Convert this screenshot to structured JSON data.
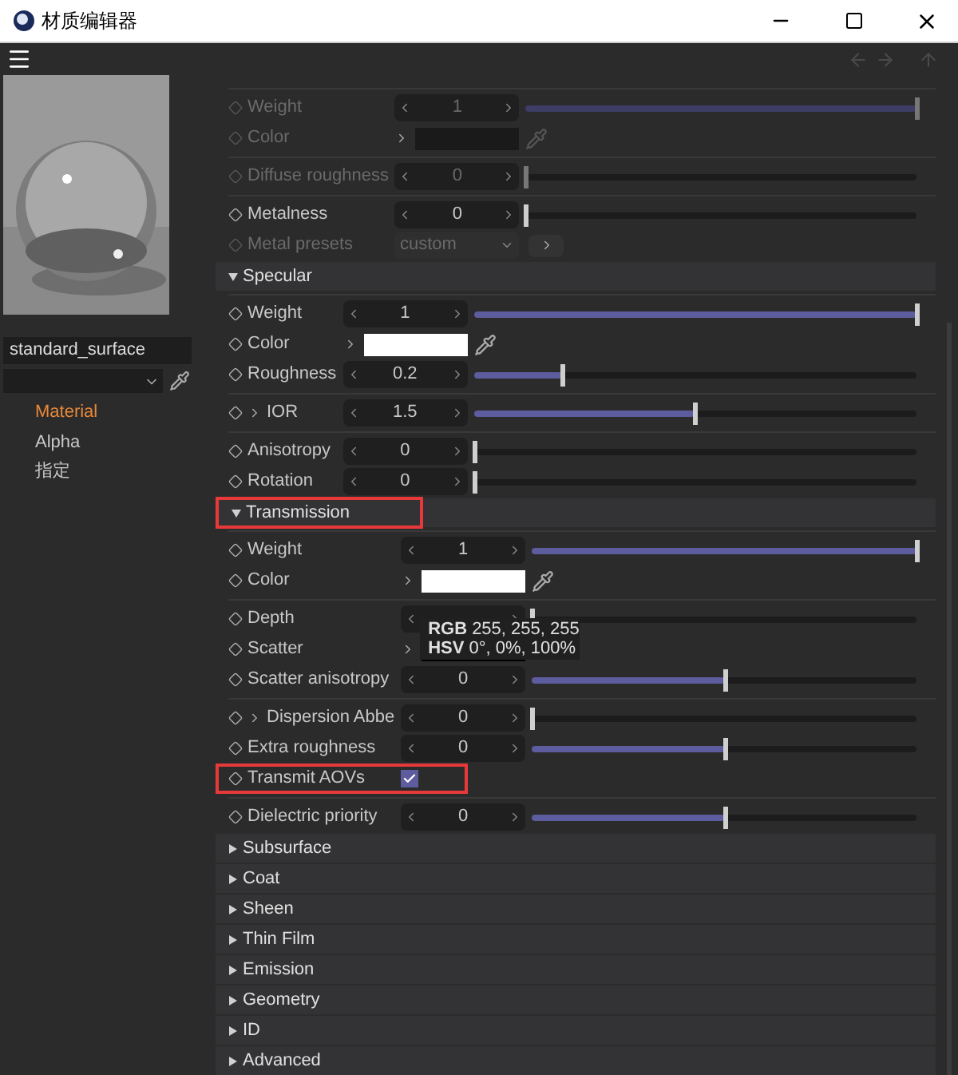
{
  "window": {
    "title": "材质编辑器"
  },
  "sidebar": {
    "material_name": "standard_surface",
    "items": [
      {
        "label": "Material",
        "selected": true
      },
      {
        "label": "Alpha",
        "selected": false
      },
      {
        "label": "指定",
        "selected": false
      }
    ]
  },
  "sections": [
    {
      "groups": [
        [
          {
            "kind": "slider",
            "label": "Weight",
            "value": "1",
            "level": 1,
            "disabled": true
          },
          {
            "kind": "color",
            "label": "Color",
            "disabled": true,
            "eyedropper": true
          }
        ],
        [
          {
            "kind": "slider",
            "label": "Diffuse roughness",
            "value": "0",
            "level": 0,
            "disabled": true
          }
        ],
        [
          {
            "kind": "slider",
            "label": "Metalness",
            "value": "0",
            "level": 0,
            "disabled": false
          },
          {
            "kind": "dropdown",
            "label": "Metal presets",
            "value": "custom",
            "disabled": true
          }
        ]
      ]
    },
    {
      "title": "Specular",
      "expanded": true,
      "highlighted": false,
      "groups": [
        [
          {
            "kind": "slider",
            "label": "Weight",
            "value": "1",
            "level": 1,
            "disabled": false
          },
          {
            "kind": "color",
            "label": "Color",
            "color": "#ffffff",
            "disabled": false,
            "eyedropper": true
          },
          {
            "kind": "slider",
            "label": "Roughness",
            "value": "0.2",
            "level": 0.2,
            "disabled": false
          }
        ],
        [
          {
            "kind": "slider",
            "label": "IOR",
            "has_children": true,
            "value": "1.5",
            "level": 0.5,
            "disabled": false
          }
        ],
        [
          {
            "kind": "slider",
            "label": "Anisotropy",
            "value": "0",
            "level": 0,
            "disabled": false
          },
          {
            "kind": "slider",
            "label": "Rotation",
            "value": "0",
            "level": 0,
            "disabled": false
          }
        ]
      ]
    },
    {
      "title": "Transmission",
      "expanded": true,
      "highlighted": true,
      "tooltip": [
        {
          "label": "RGB",
          "value": "255, 255, 255"
        },
        {
          "label": "HSV",
          "value": "0°, 0%, 100%"
        }
      ],
      "groups": [
        [
          {
            "kind": "slider",
            "label": "Weight",
            "value": "1",
            "level": 1,
            "disabled": false
          },
          {
            "kind": "color",
            "label": "Color",
            "color": "#ffffff",
            "disabled": false,
            "eyedropper": true
          }
        ],
        [
          {
            "kind": "slider",
            "label": "Depth",
            "level": 0,
            "disabled": false
          },
          {
            "kind": "color",
            "label": "Scatter",
            "color": "#000000",
            "disabled": false,
            "eyedropper": false
          },
          {
            "kind": "slider",
            "label": "Scatter anisotropy",
            "value": "0",
            "level": 0.5,
            "disabled": false
          }
        ],
        [
          {
            "kind": "slider",
            "label": "Dispersion Abbe",
            "has_children": true,
            "value": "0",
            "level": 0,
            "disabled": false
          },
          {
            "kind": "slider",
            "label": "Extra roughness",
            "value": "0",
            "level": 0.5,
            "disabled": false
          },
          {
            "kind": "checkbox",
            "label": "Transmit AOVs",
            "checked": true,
            "highlighted": true,
            "disabled": false
          }
        ],
        [
          {
            "kind": "slider",
            "label": "Dielectric priority",
            "value": "0",
            "level": 0.5,
            "disabled": false
          }
        ]
      ]
    },
    {
      "title": "Subsurface",
      "expanded": false,
      "highlighted": false
    },
    {
      "title": "Coat",
      "expanded": false,
      "highlighted": false
    },
    {
      "title": "Sheen",
      "expanded": false,
      "highlighted": false
    },
    {
      "title": "Thin Film",
      "expanded": false,
      "highlighted": false
    },
    {
      "title": "Emission",
      "expanded": false,
      "highlighted": false
    },
    {
      "title": "Geometry",
      "expanded": false,
      "highlighted": false
    },
    {
      "title": "ID",
      "expanded": false,
      "highlighted": false
    },
    {
      "title": "Advanced",
      "expanded": false,
      "highlighted": false
    }
  ]
}
